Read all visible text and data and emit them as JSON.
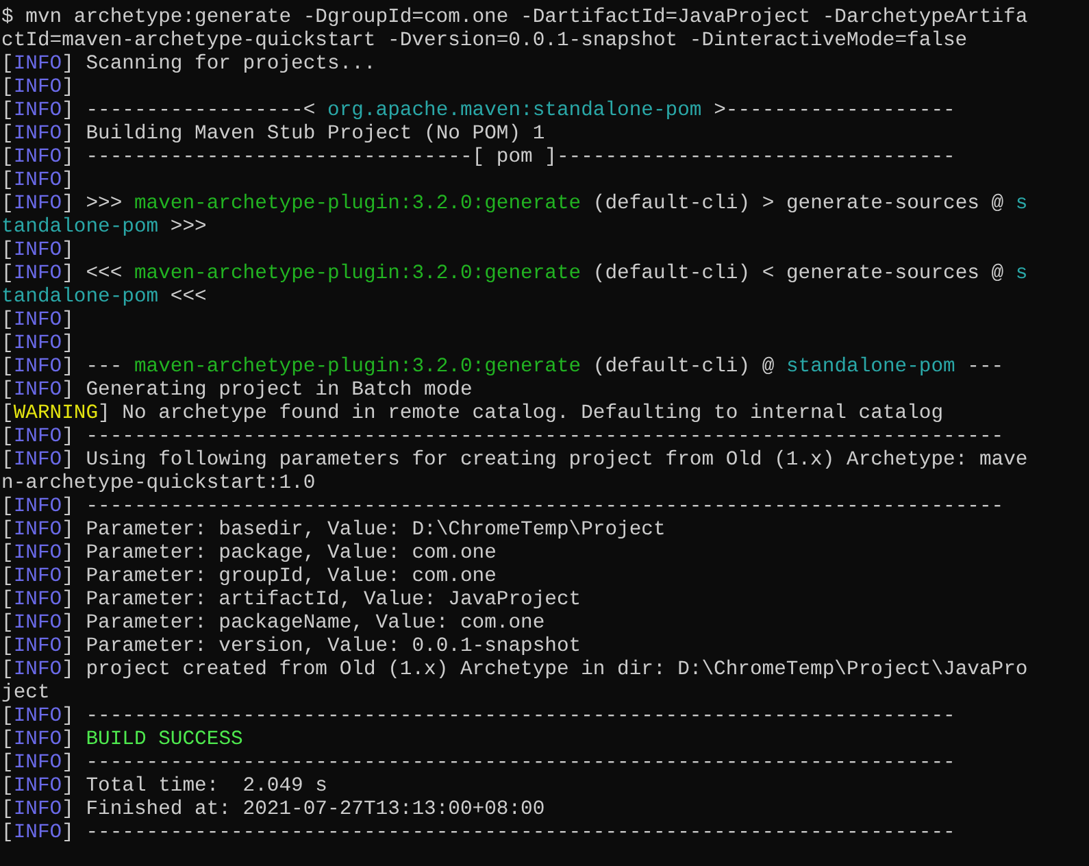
{
  "terminal": {
    "lines": [
      {
        "segments": [
          {
            "kind": "plain",
            "text": "$ mvn archetype:generate -DgroupId=com.one -DartifactId=JavaProject -DarchetypeArtifa"
          }
        ]
      },
      {
        "segments": [
          {
            "kind": "plain",
            "text": "ctId=maven-archetype-quickstart -Dversion=0.0.1-snapshot -DinteractiveMode=false"
          }
        ]
      },
      {
        "segments": [
          {
            "kind": "plain",
            "text": "["
          },
          {
            "kind": "info",
            "text": "INFO"
          },
          {
            "kind": "plain",
            "text": "] Scanning for projects..."
          }
        ]
      },
      {
        "segments": [
          {
            "kind": "plain",
            "text": "["
          },
          {
            "kind": "info",
            "text": "INFO"
          },
          {
            "kind": "plain",
            "text": "]"
          }
        ]
      },
      {
        "segments": [
          {
            "kind": "plain",
            "text": "["
          },
          {
            "kind": "info",
            "text": "INFO"
          },
          {
            "kind": "plain",
            "text": "] ------------------< "
          },
          {
            "kind": "project",
            "text": "org.apache.maven:standalone-pom"
          },
          {
            "kind": "plain",
            "text": " >-------------------"
          }
        ]
      },
      {
        "segments": [
          {
            "kind": "plain",
            "text": "["
          },
          {
            "kind": "info",
            "text": "INFO"
          },
          {
            "kind": "plain",
            "text": "] Building Maven Stub Project (No POM) 1"
          }
        ]
      },
      {
        "segments": [
          {
            "kind": "plain",
            "text": "["
          },
          {
            "kind": "info",
            "text": "INFO"
          },
          {
            "kind": "plain",
            "text": "] --------------------------------[ pom ]---------------------------------"
          }
        ]
      },
      {
        "segments": [
          {
            "kind": "plain",
            "text": "["
          },
          {
            "kind": "info",
            "text": "INFO"
          },
          {
            "kind": "plain",
            "text": "]"
          }
        ]
      },
      {
        "segments": [
          {
            "kind": "plain",
            "text": "["
          },
          {
            "kind": "info",
            "text": "INFO"
          },
          {
            "kind": "plain",
            "text": "] >>> "
          },
          {
            "kind": "plugin",
            "text": "maven-archetype-plugin:3.2.0:generate"
          },
          {
            "kind": "plain",
            "text": " (default-cli) > generate-sources @ "
          },
          {
            "kind": "project",
            "text": "s"
          }
        ]
      },
      {
        "segments": [
          {
            "kind": "project",
            "text": "tandalone-pom"
          },
          {
            "kind": "plain",
            "text": " >>>"
          }
        ]
      },
      {
        "segments": [
          {
            "kind": "plain",
            "text": "["
          },
          {
            "kind": "info",
            "text": "INFO"
          },
          {
            "kind": "plain",
            "text": "]"
          }
        ]
      },
      {
        "segments": [
          {
            "kind": "plain",
            "text": "["
          },
          {
            "kind": "info",
            "text": "INFO"
          },
          {
            "kind": "plain",
            "text": "] <<< "
          },
          {
            "kind": "plugin",
            "text": "maven-archetype-plugin:3.2.0:generate"
          },
          {
            "kind": "plain",
            "text": " (default-cli) < generate-sources @ "
          },
          {
            "kind": "project",
            "text": "s"
          }
        ]
      },
      {
        "segments": [
          {
            "kind": "project",
            "text": "tandalone-pom"
          },
          {
            "kind": "plain",
            "text": " <<<"
          }
        ]
      },
      {
        "segments": [
          {
            "kind": "plain",
            "text": "["
          },
          {
            "kind": "info",
            "text": "INFO"
          },
          {
            "kind": "plain",
            "text": "]"
          }
        ]
      },
      {
        "segments": [
          {
            "kind": "plain",
            "text": "["
          },
          {
            "kind": "info",
            "text": "INFO"
          },
          {
            "kind": "plain",
            "text": "]"
          }
        ]
      },
      {
        "segments": [
          {
            "kind": "plain",
            "text": "["
          },
          {
            "kind": "info",
            "text": "INFO"
          },
          {
            "kind": "plain",
            "text": "] --- "
          },
          {
            "kind": "plugin",
            "text": "maven-archetype-plugin:3.2.0:generate"
          },
          {
            "kind": "plain",
            "text": " (default-cli) @ "
          },
          {
            "kind": "project",
            "text": "standalone-pom"
          },
          {
            "kind": "plain",
            "text": " ---"
          }
        ]
      },
      {
        "segments": [
          {
            "kind": "plain",
            "text": "["
          },
          {
            "kind": "info",
            "text": "INFO"
          },
          {
            "kind": "plain",
            "text": "] Generating project in Batch mode"
          }
        ]
      },
      {
        "segments": [
          {
            "kind": "plain",
            "text": "["
          },
          {
            "kind": "warning",
            "text": "WARNING"
          },
          {
            "kind": "plain",
            "text": "] No archetype found in remote catalog. Defaulting to internal catalog"
          }
        ]
      },
      {
        "segments": [
          {
            "kind": "plain",
            "text": "["
          },
          {
            "kind": "info",
            "text": "INFO"
          },
          {
            "kind": "plain",
            "text": "] ----------------------------------------------------------------------------"
          }
        ]
      },
      {
        "segments": [
          {
            "kind": "plain",
            "text": "["
          },
          {
            "kind": "info",
            "text": "INFO"
          },
          {
            "kind": "plain",
            "text": "] Using following parameters for creating project from Old (1.x) Archetype: mave"
          }
        ]
      },
      {
        "segments": [
          {
            "kind": "plain",
            "text": "n-archetype-quickstart:1.0"
          }
        ]
      },
      {
        "segments": [
          {
            "kind": "plain",
            "text": "["
          },
          {
            "kind": "info",
            "text": "INFO"
          },
          {
            "kind": "plain",
            "text": "] ----------------------------------------------------------------------------"
          }
        ]
      },
      {
        "segments": [
          {
            "kind": "plain",
            "text": "["
          },
          {
            "kind": "info",
            "text": "INFO"
          },
          {
            "kind": "plain",
            "text": "] Parameter: basedir, Value: D:\\ChromeTemp\\Project"
          }
        ]
      },
      {
        "segments": [
          {
            "kind": "plain",
            "text": "["
          },
          {
            "kind": "info",
            "text": "INFO"
          },
          {
            "kind": "plain",
            "text": "] Parameter: package, Value: com.one"
          }
        ]
      },
      {
        "segments": [
          {
            "kind": "plain",
            "text": "["
          },
          {
            "kind": "info",
            "text": "INFO"
          },
          {
            "kind": "plain",
            "text": "] Parameter: groupId, Value: com.one"
          }
        ]
      },
      {
        "segments": [
          {
            "kind": "plain",
            "text": "["
          },
          {
            "kind": "info",
            "text": "INFO"
          },
          {
            "kind": "plain",
            "text": "] Parameter: artifactId, Value: JavaProject"
          }
        ]
      },
      {
        "segments": [
          {
            "kind": "plain",
            "text": "["
          },
          {
            "kind": "info",
            "text": "INFO"
          },
          {
            "kind": "plain",
            "text": "] Parameter: packageName, Value: com.one"
          }
        ]
      },
      {
        "segments": [
          {
            "kind": "plain",
            "text": "["
          },
          {
            "kind": "info",
            "text": "INFO"
          },
          {
            "kind": "plain",
            "text": "] Parameter: version, Value: 0.0.1-snapshot"
          }
        ]
      },
      {
        "segments": [
          {
            "kind": "plain",
            "text": "["
          },
          {
            "kind": "info",
            "text": "INFO"
          },
          {
            "kind": "plain",
            "text": "] project created from Old (1.x) Archetype in dir: D:\\ChromeTemp\\Project\\JavaPro"
          }
        ]
      },
      {
        "segments": [
          {
            "kind": "plain",
            "text": "ject"
          }
        ]
      },
      {
        "segments": [
          {
            "kind": "plain",
            "text": "["
          },
          {
            "kind": "info",
            "text": "INFO"
          },
          {
            "kind": "plain",
            "text": "] ------------------------------------------------------------------------"
          }
        ]
      },
      {
        "segments": [
          {
            "kind": "plain",
            "text": "["
          },
          {
            "kind": "info",
            "text": "INFO"
          },
          {
            "kind": "plain",
            "text": "] "
          },
          {
            "kind": "success",
            "text": "BUILD SUCCESS"
          }
        ]
      },
      {
        "segments": [
          {
            "kind": "plain",
            "text": "["
          },
          {
            "kind": "info",
            "text": "INFO"
          },
          {
            "kind": "plain",
            "text": "] ------------------------------------------------------------------------"
          }
        ]
      },
      {
        "segments": [
          {
            "kind": "plain",
            "text": "["
          },
          {
            "kind": "info",
            "text": "INFO"
          },
          {
            "kind": "plain",
            "text": "] Total time:  2.049 s"
          }
        ]
      },
      {
        "segments": [
          {
            "kind": "plain",
            "text": "["
          },
          {
            "kind": "info",
            "text": "INFO"
          },
          {
            "kind": "plain",
            "text": "] Finished at: 2021-07-27T13:13:00+08:00"
          }
        ]
      },
      {
        "segments": [
          {
            "kind": "plain",
            "text": "["
          },
          {
            "kind": "info",
            "text": "INFO"
          },
          {
            "kind": "plain",
            "text": "] ------------------------------------------------------------------------"
          }
        ]
      }
    ]
  }
}
